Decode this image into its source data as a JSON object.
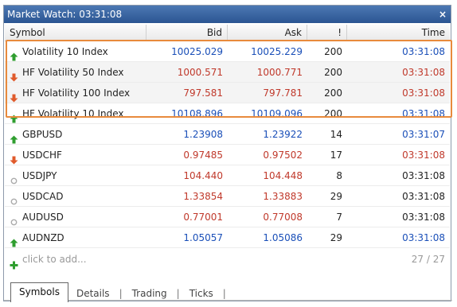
{
  "window": {
    "title": "Market Watch: 03:31:08",
    "close_glyph": "×"
  },
  "columns": {
    "symbol": "Symbol",
    "bid": "Bid",
    "ask": "Ask",
    "spread": "!",
    "time": "Time"
  },
  "rows": [
    {
      "symbol": "Volatility 10 Index",
      "bid": "10025.029",
      "ask": "10025.229",
      "spread": "200",
      "time": "03:31:08",
      "trend": "up"
    },
    {
      "symbol": "HF Volatility 50 Index",
      "bid": "1000.571",
      "ask": "1000.771",
      "spread": "200",
      "time": "03:31:08",
      "trend": "down"
    },
    {
      "symbol": "HF Volatility 100 Index",
      "bid": "797.581",
      "ask": "797.781",
      "spread": "200",
      "time": "03:31:08",
      "trend": "down"
    },
    {
      "symbol": "HF Volatility 10 Index",
      "bid": "10108.896",
      "ask": "10109.096",
      "spread": "200",
      "time": "03:31:08",
      "trend": "up"
    },
    {
      "symbol": "GBPUSD",
      "bid": "1.23908",
      "ask": "1.23922",
      "spread": "14",
      "time": "03:31:07",
      "trend": "up"
    },
    {
      "symbol": "USDCHF",
      "bid": "0.97485",
      "ask": "0.97502",
      "spread": "17",
      "time": "03:31:08",
      "trend": "down"
    },
    {
      "symbol": "USDJPY",
      "bid": "104.440",
      "ask": "104.448",
      "spread": "8",
      "time": "03:31:08",
      "trend": "neutral"
    },
    {
      "symbol": "USDCAD",
      "bid": "1.33854",
      "ask": "1.33883",
      "spread": "29",
      "time": "03:31:08",
      "trend": "neutral"
    },
    {
      "symbol": "AUDUSD",
      "bid": "0.77001",
      "ask": "0.77008",
      "spread": "7",
      "time": "03:31:08",
      "trend": "neutral"
    },
    {
      "symbol": "AUDNZD",
      "bid": "1.05057",
      "ask": "1.05086",
      "spread": "29",
      "time": "03:31:08",
      "trend": "up"
    }
  ],
  "add_row": {
    "label": "click to add...",
    "count": "27 / 27"
  },
  "tabs": [
    "Symbols",
    "Details",
    "Trading",
    "Ticks"
  ],
  "colors": {
    "up": "#2f9e2f",
    "down": "#e05a2b",
    "neutral": "#aaaaaa",
    "blue_value": "#1a4fb8",
    "red_value": "#c0392b",
    "highlight": "#e88a3c",
    "titlebar": "#2b5592"
  },
  "icons": {
    "up": "arrow-up-icon",
    "down": "arrow-down-icon",
    "neutral": "circle-icon",
    "add": "plus-icon"
  }
}
